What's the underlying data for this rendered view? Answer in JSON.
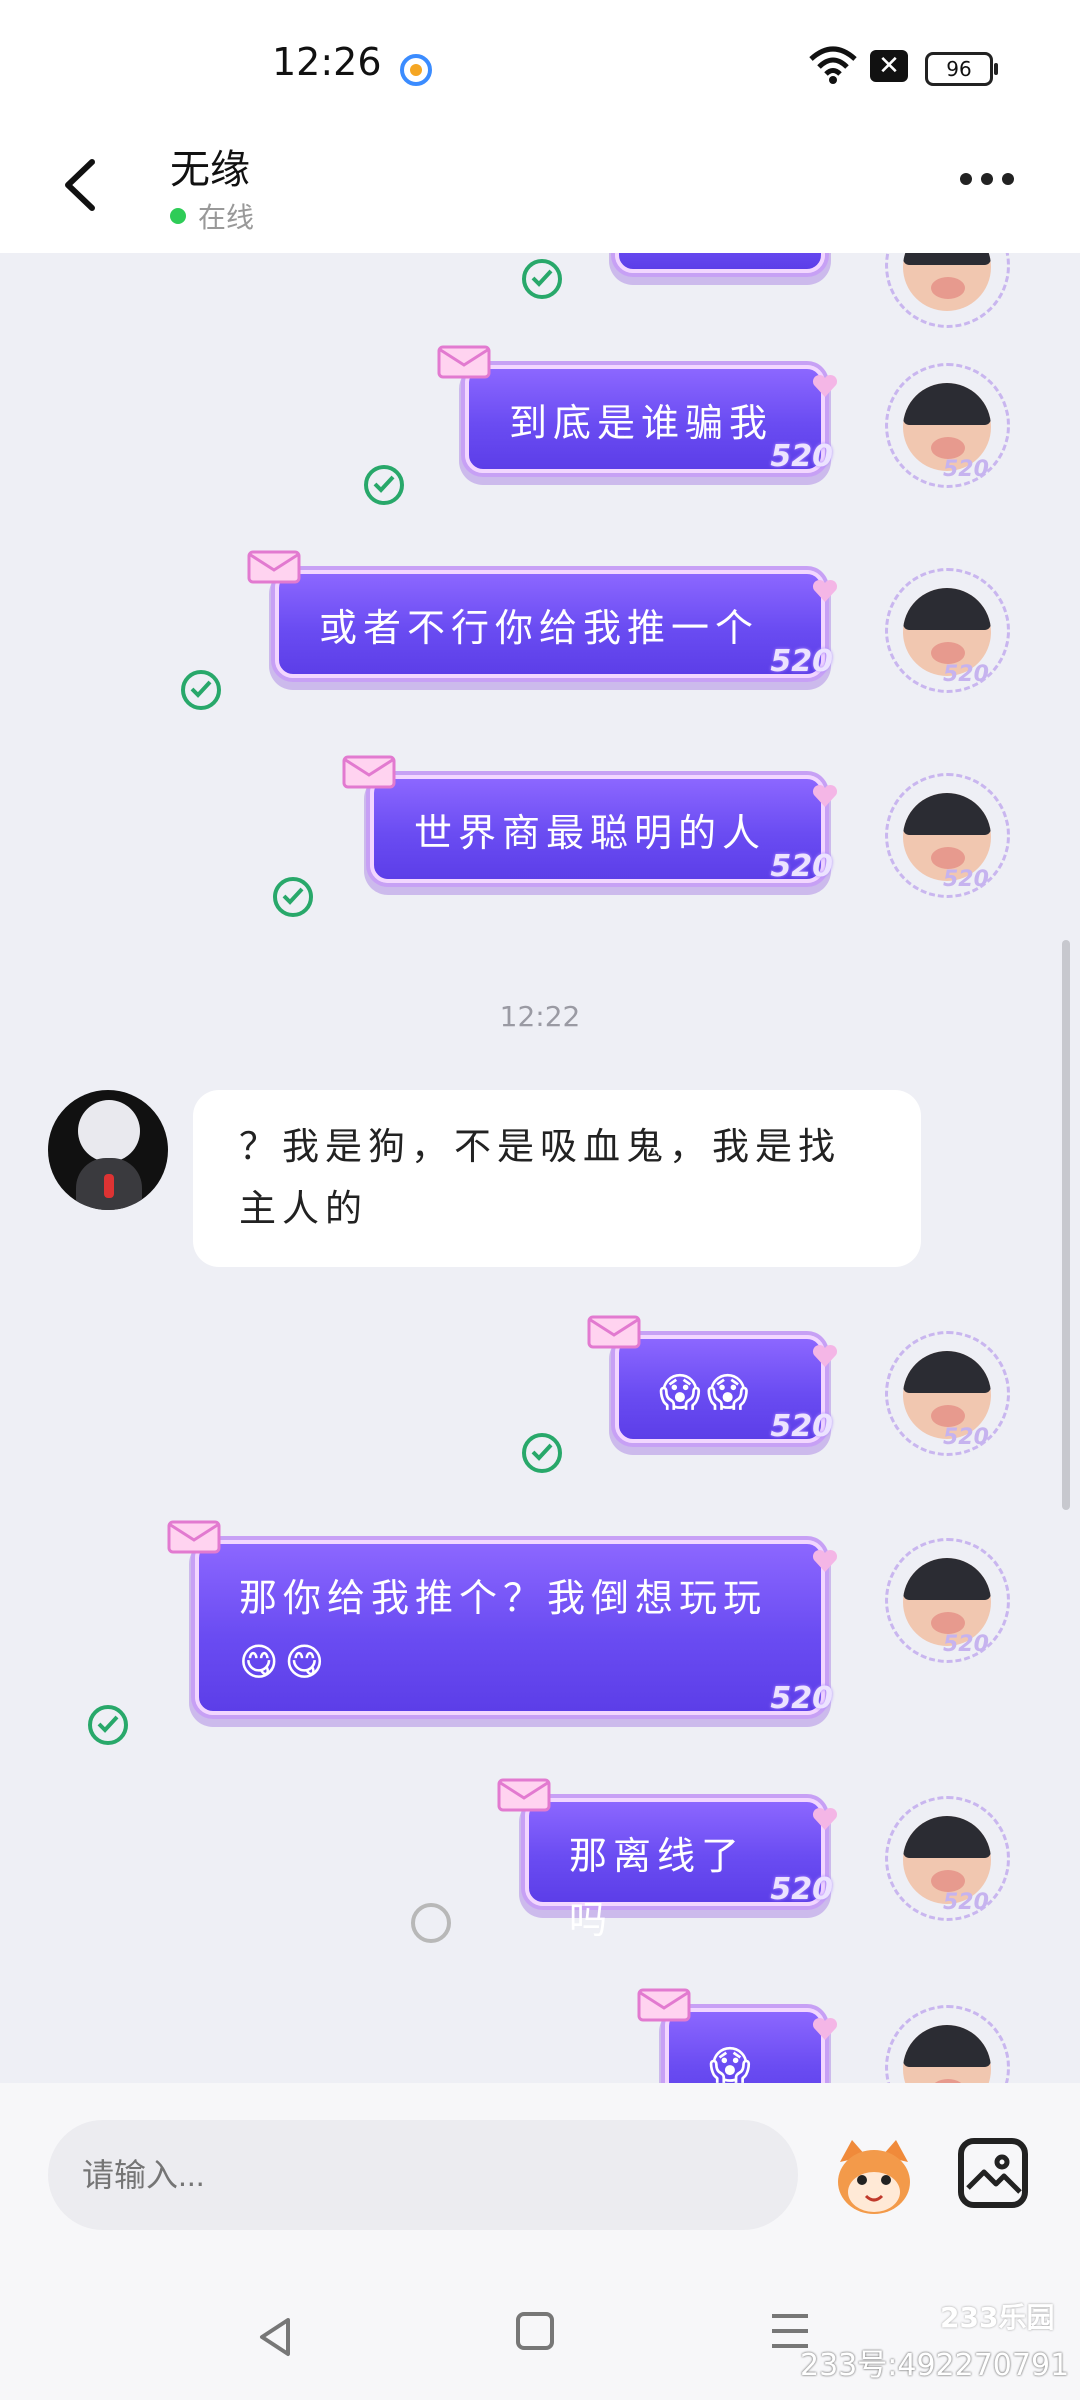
{
  "status_bar": {
    "time": "12:26",
    "battery": "96"
  },
  "header": {
    "contact_name": "无缘",
    "status": "在线"
  },
  "chat": {
    "timestamp": "12:22",
    "bubble_tag": "520",
    "avatar_tag": "520",
    "messages": [
      {
        "side": "out",
        "text": "到底是谁骗我",
        "state": "read"
      },
      {
        "side": "out",
        "text": "或者不行你给我推一个",
        "state": "read"
      },
      {
        "side": "out",
        "text": "世界商最聪明的人",
        "state": "read"
      },
      {
        "side": "in",
        "text": "？我是狗，不是吸血鬼，我是找主人的"
      },
      {
        "side": "out",
        "text": "😱😱",
        "state": "read"
      },
      {
        "side": "out",
        "text": "那你给我推个？我倒想玩玩😋😋",
        "state": "read"
      },
      {
        "side": "out",
        "text": "那离线了吗",
        "state": "pending"
      },
      {
        "side": "out",
        "text": "😱",
        "state": "sending"
      }
    ]
  },
  "input": {
    "placeholder": "请输入..."
  },
  "watermark": {
    "text": "233号:492270791",
    "logo": "233乐园"
  },
  "colors": {
    "bubble_out": "#6a4cf2",
    "read_check": "#28a86a",
    "online": "#2ecc57"
  }
}
